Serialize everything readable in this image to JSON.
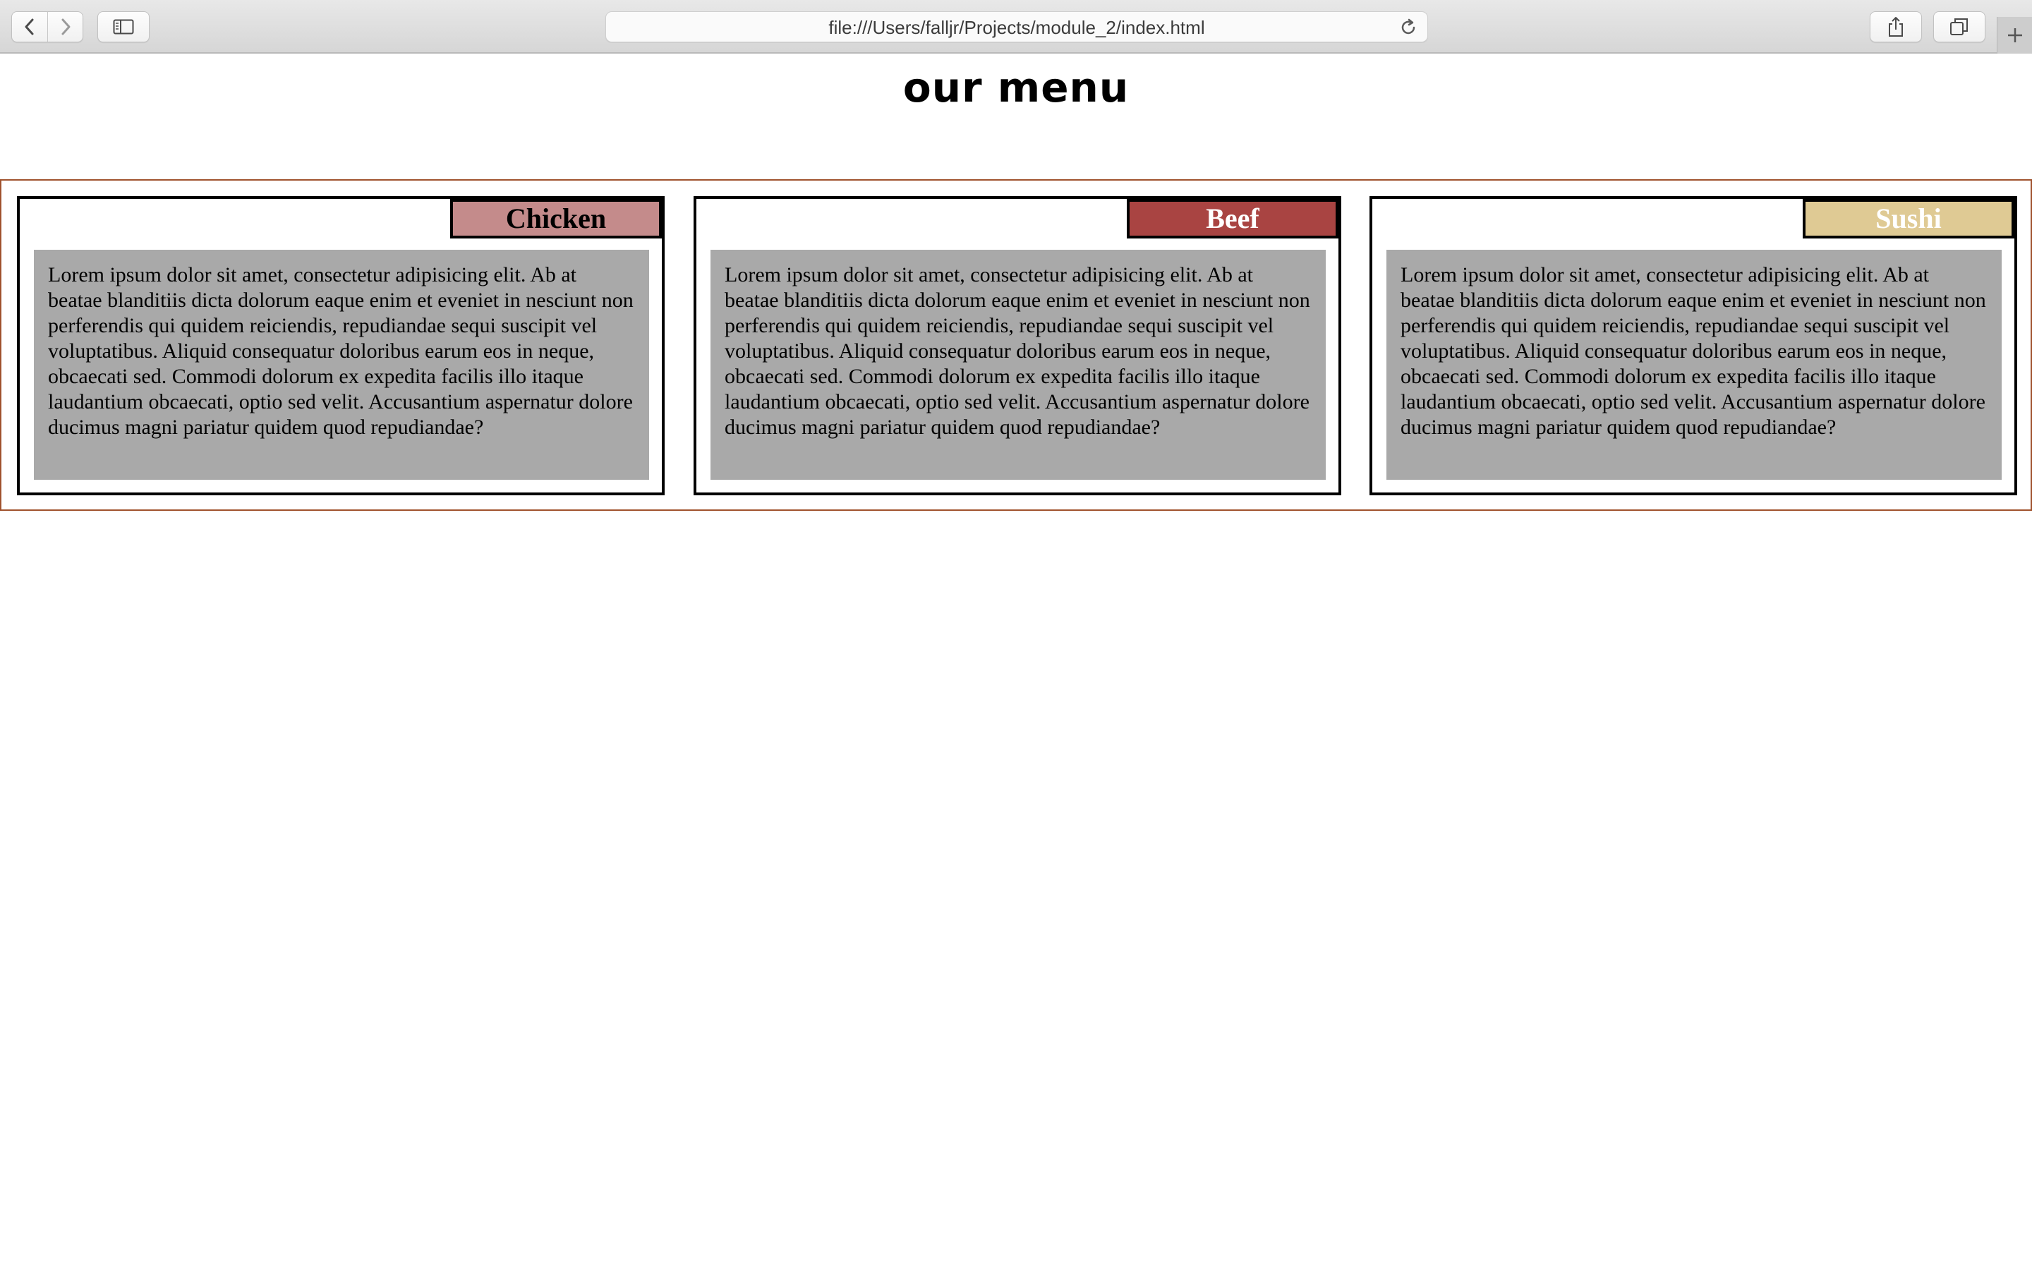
{
  "browser": {
    "url": "file:///Users/falljr/Projects/module_2/index.html"
  },
  "page": {
    "title": "our menu"
  },
  "colors": {
    "container_border": "#a0522d",
    "chicken_label_bg": "#c48b8b",
    "beef_label_bg": "#a94442",
    "sushi_label_bg": "#dfca94",
    "text_box_bg": "#a9a9a9"
  },
  "menu": {
    "items": [
      {
        "label": "Chicken",
        "description": "Lorem ipsum dolor sit amet, consectetur adipisicing elit. Ab at beatae blanditiis dicta dolorum eaque enim et eveniet in nesciunt non perferendis qui quidem reiciendis, repudiandae sequi suscipit vel voluptatibus. Aliquid consequatur doloribus earum eos in neque, obcaecati sed. Commodi dolorum ex expedita facilis illo itaque laudantium obcaecati, optio sed velit. Accusantium aspernatur dolore ducimus magni pariatur quidem quod repudiandae?"
      },
      {
        "label": "Beef",
        "description": "Lorem ipsum dolor sit amet, consectetur adipisicing elit. Ab at beatae blanditiis dicta dolorum eaque enim et eveniet in nesciunt non perferendis qui quidem reiciendis, repudiandae sequi suscipit vel voluptatibus. Aliquid consequatur doloribus earum eos in neque, obcaecati sed. Commodi dolorum ex expedita facilis illo itaque laudantium obcaecati, optio sed velit. Accusantium aspernatur dolore ducimus magni pariatur quidem quod repudiandae?"
      },
      {
        "label": "Sushi",
        "description": "Lorem ipsum dolor sit amet, consectetur adipisicing elit. Ab at beatae blanditiis dicta dolorum eaque enim et eveniet in nesciunt non perferendis qui quidem reiciendis, repudiandae sequi suscipit vel voluptatibus. Aliquid consequatur doloribus earum eos in neque, obcaecati sed. Commodi dolorum ex expedita facilis illo itaque laudantium obcaecati, optio sed velit. Accusantium aspernatur dolore ducimus magni pariatur quidem quod repudiandae?"
      }
    ]
  }
}
